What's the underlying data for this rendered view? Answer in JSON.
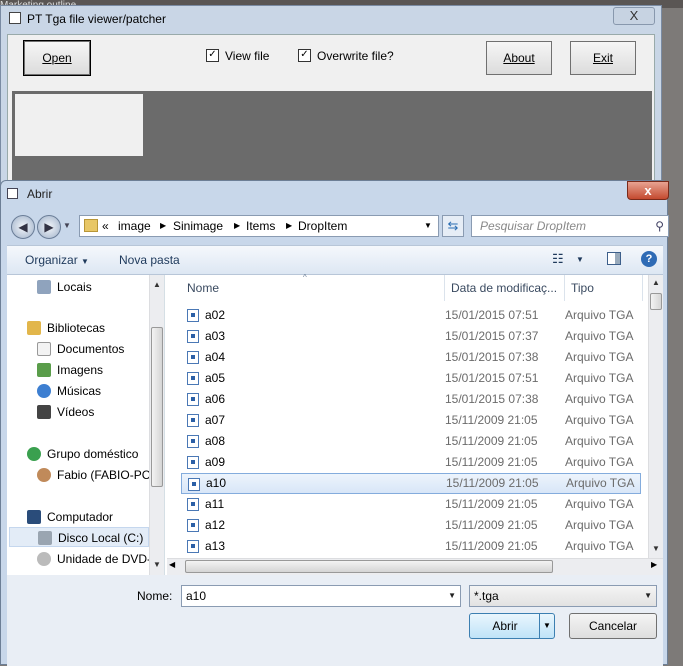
{
  "background_text": "Marketing outline",
  "back_window": {
    "title": "PT Tga file viewer/patcher",
    "close_glyph": "X",
    "open_label": "Open",
    "view_file_label": "View file",
    "overwrite_label": "Overwrite file?",
    "about_label": "About",
    "exit_label": "Exit",
    "view_file_checked": true,
    "overwrite_checked": true
  },
  "dialog": {
    "title": "Abrir",
    "close_glyph": "x",
    "address": [
      "«",
      "image",
      "Sinimage",
      "Items",
      "DropItem"
    ],
    "search_placeholder": "Pesquisar DropItem",
    "toolbar": {
      "organize": "Organizar",
      "new_folder": "Nova pasta"
    },
    "nav": [
      {
        "label": "Locais",
        "icon": "recent-places-icon"
      },
      {
        "label": "Bibliotecas",
        "icon": "libraries-icon"
      },
      {
        "label": "Documentos",
        "icon": "documents-icon"
      },
      {
        "label": "Imagens",
        "icon": "images-icon"
      },
      {
        "label": "Músicas",
        "icon": "music-icon"
      },
      {
        "label": "Vídeos",
        "icon": "videos-icon"
      },
      {
        "label": "Grupo doméstico",
        "icon": "homegroup-icon"
      },
      {
        "label": "Fabio (FABIO-PC",
        "icon": "user-icon"
      },
      {
        "label": "Computador",
        "icon": "computer-icon"
      },
      {
        "label": "Disco Local (C:)",
        "icon": "local-disk-icon"
      },
      {
        "label": "Unidade de DVD-",
        "icon": "dvd-drive-icon"
      }
    ],
    "columns": {
      "name": "Nome",
      "date": "Data de modificaç...",
      "type": "Tipo"
    },
    "files": [
      {
        "name": "a02",
        "date": "15/01/2015 07:51",
        "type": "Arquivo TGA"
      },
      {
        "name": "a03",
        "date": "15/01/2015 07:37",
        "type": "Arquivo TGA"
      },
      {
        "name": "a04",
        "date": "15/01/2015 07:38",
        "type": "Arquivo TGA"
      },
      {
        "name": "a05",
        "date": "15/01/2015 07:51",
        "type": "Arquivo TGA"
      },
      {
        "name": "a06",
        "date": "15/01/2015 07:38",
        "type": "Arquivo TGA"
      },
      {
        "name": "a07",
        "date": "15/11/2009 21:05",
        "type": "Arquivo TGA"
      },
      {
        "name": "a08",
        "date": "15/11/2009 21:05",
        "type": "Arquivo TGA"
      },
      {
        "name": "a09",
        "date": "15/11/2009 21:05",
        "type": "Arquivo TGA"
      },
      {
        "name": "a10",
        "date": "15/11/2009 21:05",
        "type": "Arquivo TGA"
      },
      {
        "name": "a11",
        "date": "15/11/2009 21:05",
        "type": "Arquivo TGA"
      },
      {
        "name": "a12",
        "date": "15/11/2009 21:05",
        "type": "Arquivo TGA"
      },
      {
        "name": "a13",
        "date": "15/11/2009 21:05",
        "type": "Arquivo TGA"
      }
    ],
    "selected_file": "a10",
    "filename_label": "Nome:",
    "filename_value": "a10",
    "filter_value": "*.tga",
    "open_button": "Abrir",
    "cancel_button": "Cancelar"
  }
}
